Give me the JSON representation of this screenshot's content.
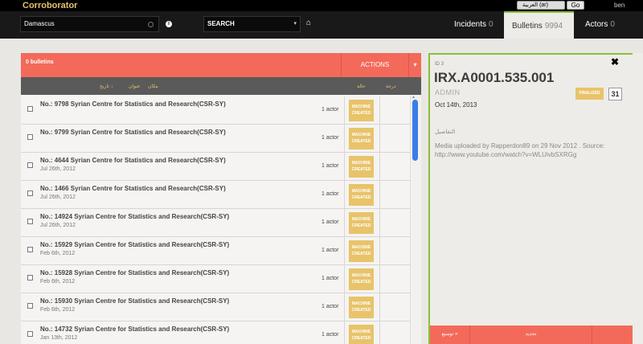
{
  "app": {
    "brand": "Corroborator",
    "language": "العربية (ar)",
    "go": "Go",
    "user": "ben"
  },
  "search": {
    "value": "Damascus",
    "info_icon": "i",
    "select": "SEARCH",
    "chevron": "▾",
    "home_icon": "⌂"
  },
  "tabs": [
    {
      "label": "Incidents",
      "count": "0"
    },
    {
      "label": "Bulletins",
      "count": "9994"
    },
    {
      "label": "Actors",
      "count": "0"
    }
  ],
  "list": {
    "count": "0 bulletins",
    "actions": "ACTIONS",
    "actions_arrow": "▾",
    "columns": {
      "date": "تاريخ",
      "title": "عنوان",
      "location": "مكان",
      "status": "حالة",
      "score": "درجة"
    },
    "rows": [
      {
        "title": "No.: 9798 Syrian Centre for Statistics and Research(CSR-SY)",
        "date": "",
        "actors": "1 actor",
        "badge_line1": "MACHINE",
        "badge_line2": "CREATED"
      },
      {
        "title": "No.: 9799 Syrian Centre for Statistics and Research(CSR-SY)",
        "date": "",
        "actors": "1 actor",
        "badge_line1": "MACHINE",
        "badge_line2": "CREATED"
      },
      {
        "title": "No.: 4644 Syrian Centre for Statistics and Research(CSR-SY)",
        "date": "Jul 26th, 2012",
        "actors": "1 actor",
        "badge_line1": "MACHINE",
        "badge_line2": "CREATED"
      },
      {
        "title": "No.: 1466 Syrian Centre for Statistics and Research(CSR-SY)",
        "date": "Jul 26th, 2012",
        "actors": "1 actor",
        "badge_line1": "MACHINE",
        "badge_line2": "CREATED"
      },
      {
        "title": "No.: 14924 Syrian Centre for Statistics and Research(CSR-SY)",
        "date": "Jul 26th, 2012",
        "actors": "1 actor",
        "badge_line1": "MACHINE",
        "badge_line2": "CREATED"
      },
      {
        "title": "No.: 15929 Syrian Centre for Statistics and Research(CSR-SY)",
        "date": "Feb 6th, 2012",
        "actors": "1 actor",
        "badge_line1": "MACHINE",
        "badge_line2": "CREATED"
      },
      {
        "title": "No.: 15928 Syrian Centre for Statistics and Research(CSR-SY)",
        "date": "Feb 6th, 2012",
        "actors": "1 actor",
        "badge_line1": "MACHINE",
        "badge_line2": "CREATED"
      },
      {
        "title": "No.: 15930 Syrian Centre for Statistics and Research(CSR-SY)",
        "date": "Feb 6th, 2012",
        "actors": "1 actor",
        "badge_line1": "MACHINE",
        "badge_line2": "CREATED"
      },
      {
        "title": "No.: 14732 Syrian Centre for Statistics and Research(CSR-SY)",
        "date": "Jan 13th, 2012",
        "actors": "1 actor",
        "badge_line1": "MACHINE",
        "badge_line2": "CREATED"
      }
    ]
  },
  "detail": {
    "close": "✖",
    "id_label": "ID 3",
    "id": "IRX.A0001.535.001",
    "source": "ADMIN",
    "status": "FINALIZED",
    "calendar": "31",
    "date": "Oct 14th, 2013",
    "details_label": "التفاصيل",
    "description": "Media uploaded by Rapperdon89 on 29 Nov 2012 . Source: http://www.youtube.com/watch?v=WLUivbSXRGg",
    "footer_expand": "توسيع »",
    "footer_update": "تحديد"
  }
}
